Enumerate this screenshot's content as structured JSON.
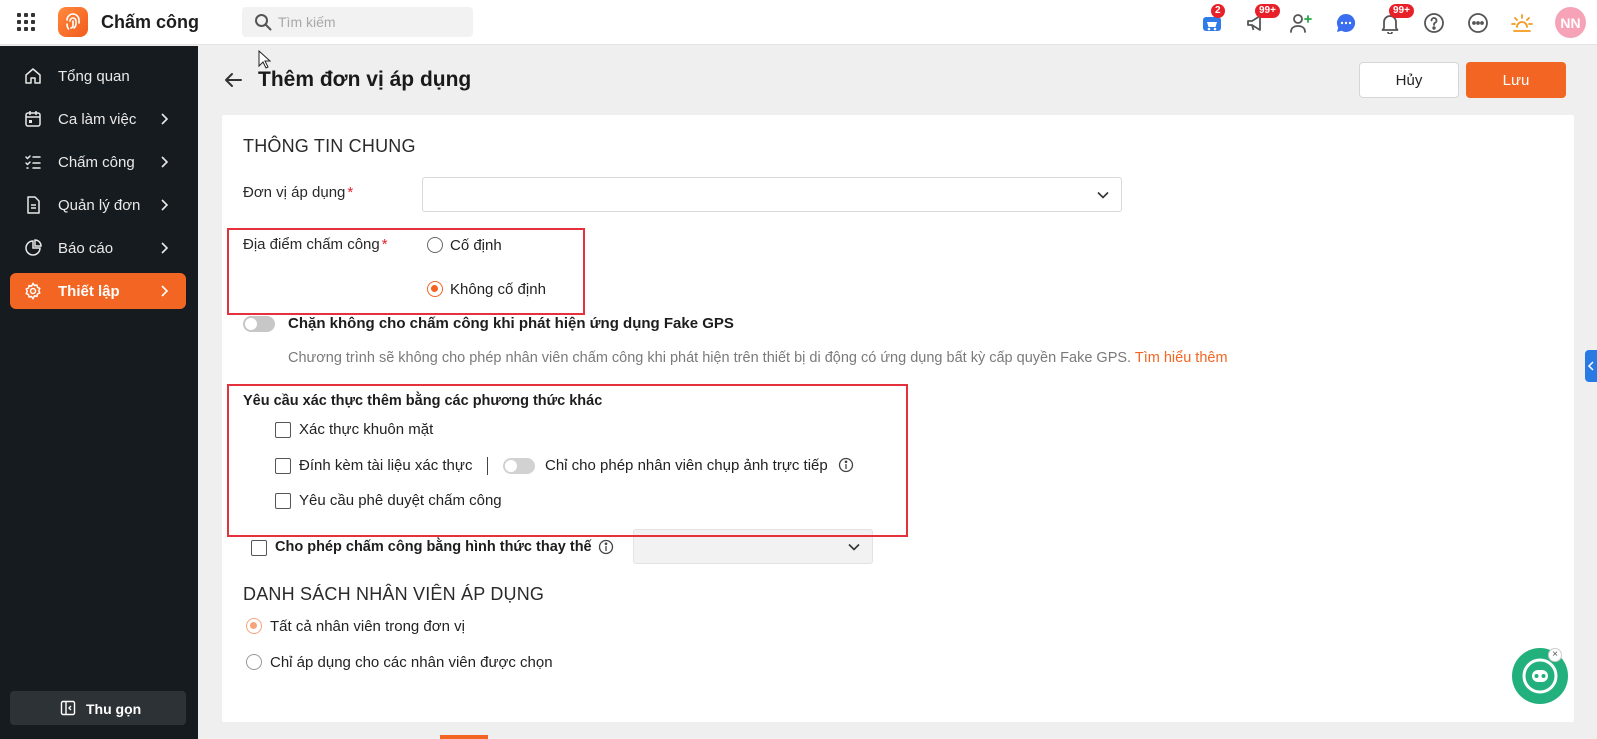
{
  "app": {
    "title": "Chấm công",
    "brand_color": "#f26522"
  },
  "search": {
    "placeholder": "Tìm kiếm"
  },
  "topbar": {
    "icons": [
      {
        "name": "cart-icon",
        "badge": "2"
      },
      {
        "name": "megaphone-icon",
        "badge": "99+"
      },
      {
        "name": "add-user-icon",
        "badge": ""
      },
      {
        "name": "chat-icon",
        "badge": ""
      },
      {
        "name": "bell-icon",
        "badge": "99+"
      },
      {
        "name": "help-icon",
        "badge": ""
      },
      {
        "name": "more-icon",
        "badge": ""
      },
      {
        "name": "lightbulb-icon",
        "badge": ""
      }
    ],
    "avatar": "NN"
  },
  "sidebar": {
    "items": [
      {
        "label": "Tổng quan",
        "icon": "home-icon",
        "has_arrow": false,
        "active": false
      },
      {
        "label": "Ca làm việc",
        "icon": "calendar-icon",
        "has_arrow": true,
        "active": false
      },
      {
        "label": "Chấm công",
        "icon": "checklist-icon",
        "has_arrow": true,
        "active": false
      },
      {
        "label": "Quản lý đơn",
        "icon": "document-icon",
        "has_arrow": true,
        "active": false
      },
      {
        "label": "Báo cáo",
        "icon": "pie-chart-icon",
        "has_arrow": true,
        "active": false
      },
      {
        "label": "Thiết lập",
        "icon": "gear-icon",
        "has_arrow": true,
        "active": true
      }
    ],
    "collapse_label": "Thu gọn"
  },
  "page": {
    "title": "Thêm đơn vị áp dụng",
    "cancel_label": "Hủy",
    "save_label": "Lưu"
  },
  "general": {
    "section_title": "THÔNG TIN CHUNG",
    "unit_label": "Đơn vị áp dụng",
    "unit_value": "",
    "location_label": "Địa điểm chấm công",
    "location_options": [
      "Cố định",
      "Không cố định"
    ],
    "location_selected": "Không cố định",
    "fake_gps_label": "Chặn không cho chấm công khi phát hiện ứng dụng Fake GPS",
    "fake_gps_enabled": false,
    "fake_gps_desc": "Chương trình sẽ không cho phép nhân viên chấm công khi phát hiện trên thiết bị di động có ứng dụng bất kỳ cấp quyền Fake GPS.",
    "learn_more": "Tìm hiểu thêm",
    "extra_auth_title": "Yêu cầu xác thực thêm bằng các phương thức khác",
    "face_auth_label": "Xác thực khuôn mặt",
    "attach_doc_label": "Đính kèm tài liệu xác thực",
    "live_photo_label": "Chỉ cho phép nhân viên chụp ảnh trực tiếp",
    "approval_label": "Yêu cầu phê duyệt chấm công",
    "alt_method_label": "Cho phép chấm công bằng hình thức thay thế",
    "alt_method_value": ""
  },
  "employees": {
    "section_title": "DANH SÁCH NHÂN VIÊN ÁP DỤNG",
    "options": [
      "Tất cả nhân viên trong đơn vị",
      "Chỉ áp dụng cho các nhân viên được chọn"
    ],
    "selected": "Tất cả nhân viên trong đơn vị"
  }
}
